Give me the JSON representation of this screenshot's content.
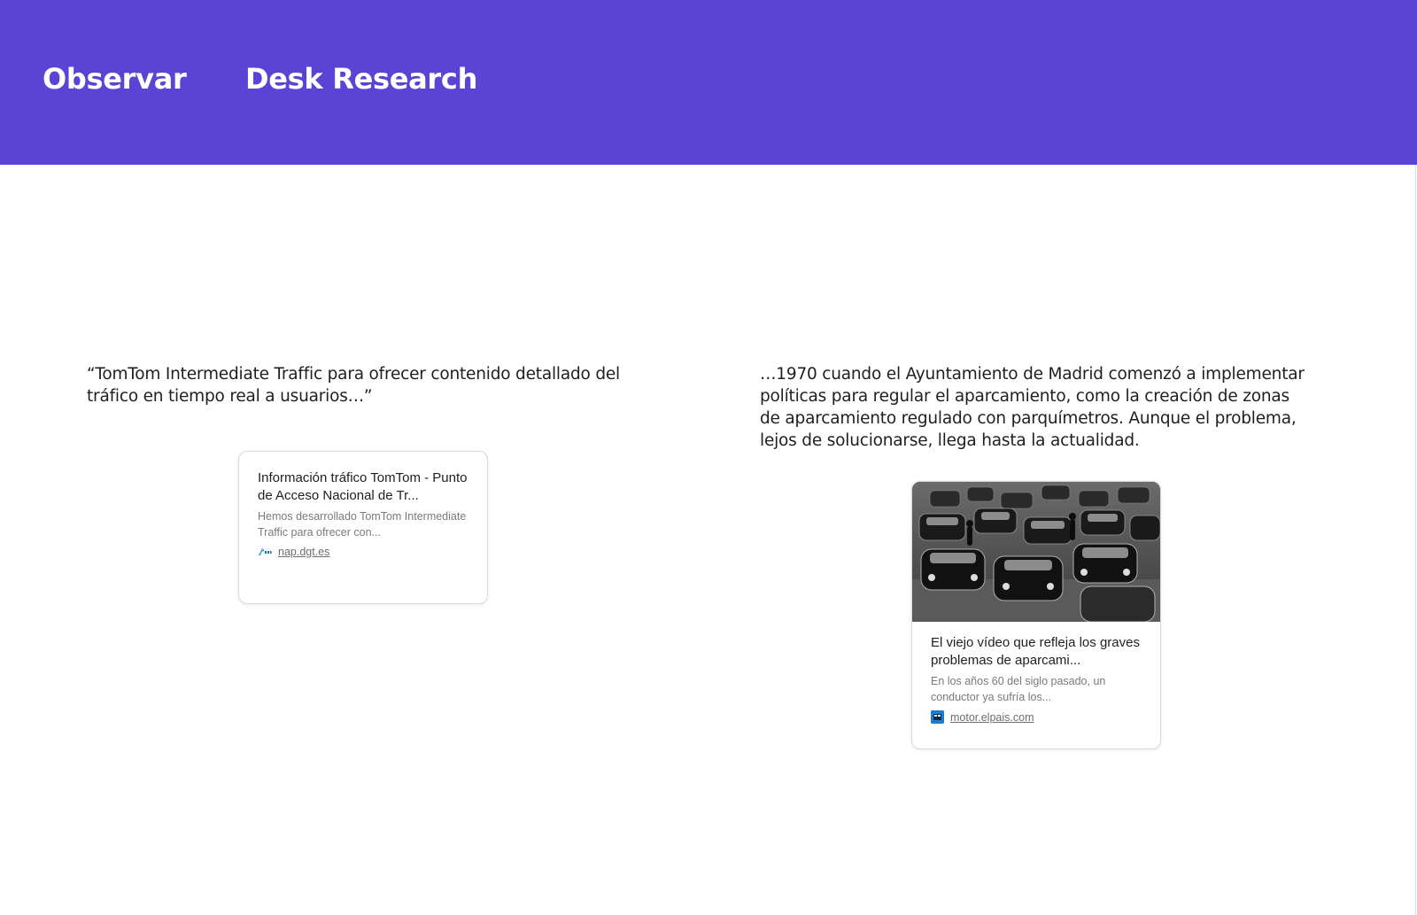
{
  "header": {
    "section": "Observar",
    "page": "Desk Research",
    "bg_color": "#5b43d6"
  },
  "left": {
    "quote": "“TomTom Intermediate Traffic para ofrecer contenido detallado del tráfico en tiempo real a usuarios…”",
    "card": {
      "title": "Información tráfico TomTom - Punto de Acceso Nacional de Tr...",
      "description": "Hemos desarrollado TomTom Intermediate Traffic para ofrecer con...",
      "source": "nap.dgt.es",
      "favicon": "dgt-logo-icon"
    }
  },
  "right": {
    "quote": "…1970 cuando el Ayuntamiento de Madrid comenzó a implementar políticas para regular el aparcamiento, como la creación de zonas de aparcamiento regulado con parquímetros. Aunque el problema, lejos de solucionarse, llega hasta la actualidad.",
    "card": {
      "title": "El viejo vídeo que refleja los graves problemas de aparcami...",
      "description": "En los años 60 del siglo pasado, un conductor ya sufría los...",
      "source": "motor.elpais.com",
      "favicon": "elpais-logo-icon",
      "image": "black-and-white-traffic-jam-photo"
    }
  }
}
